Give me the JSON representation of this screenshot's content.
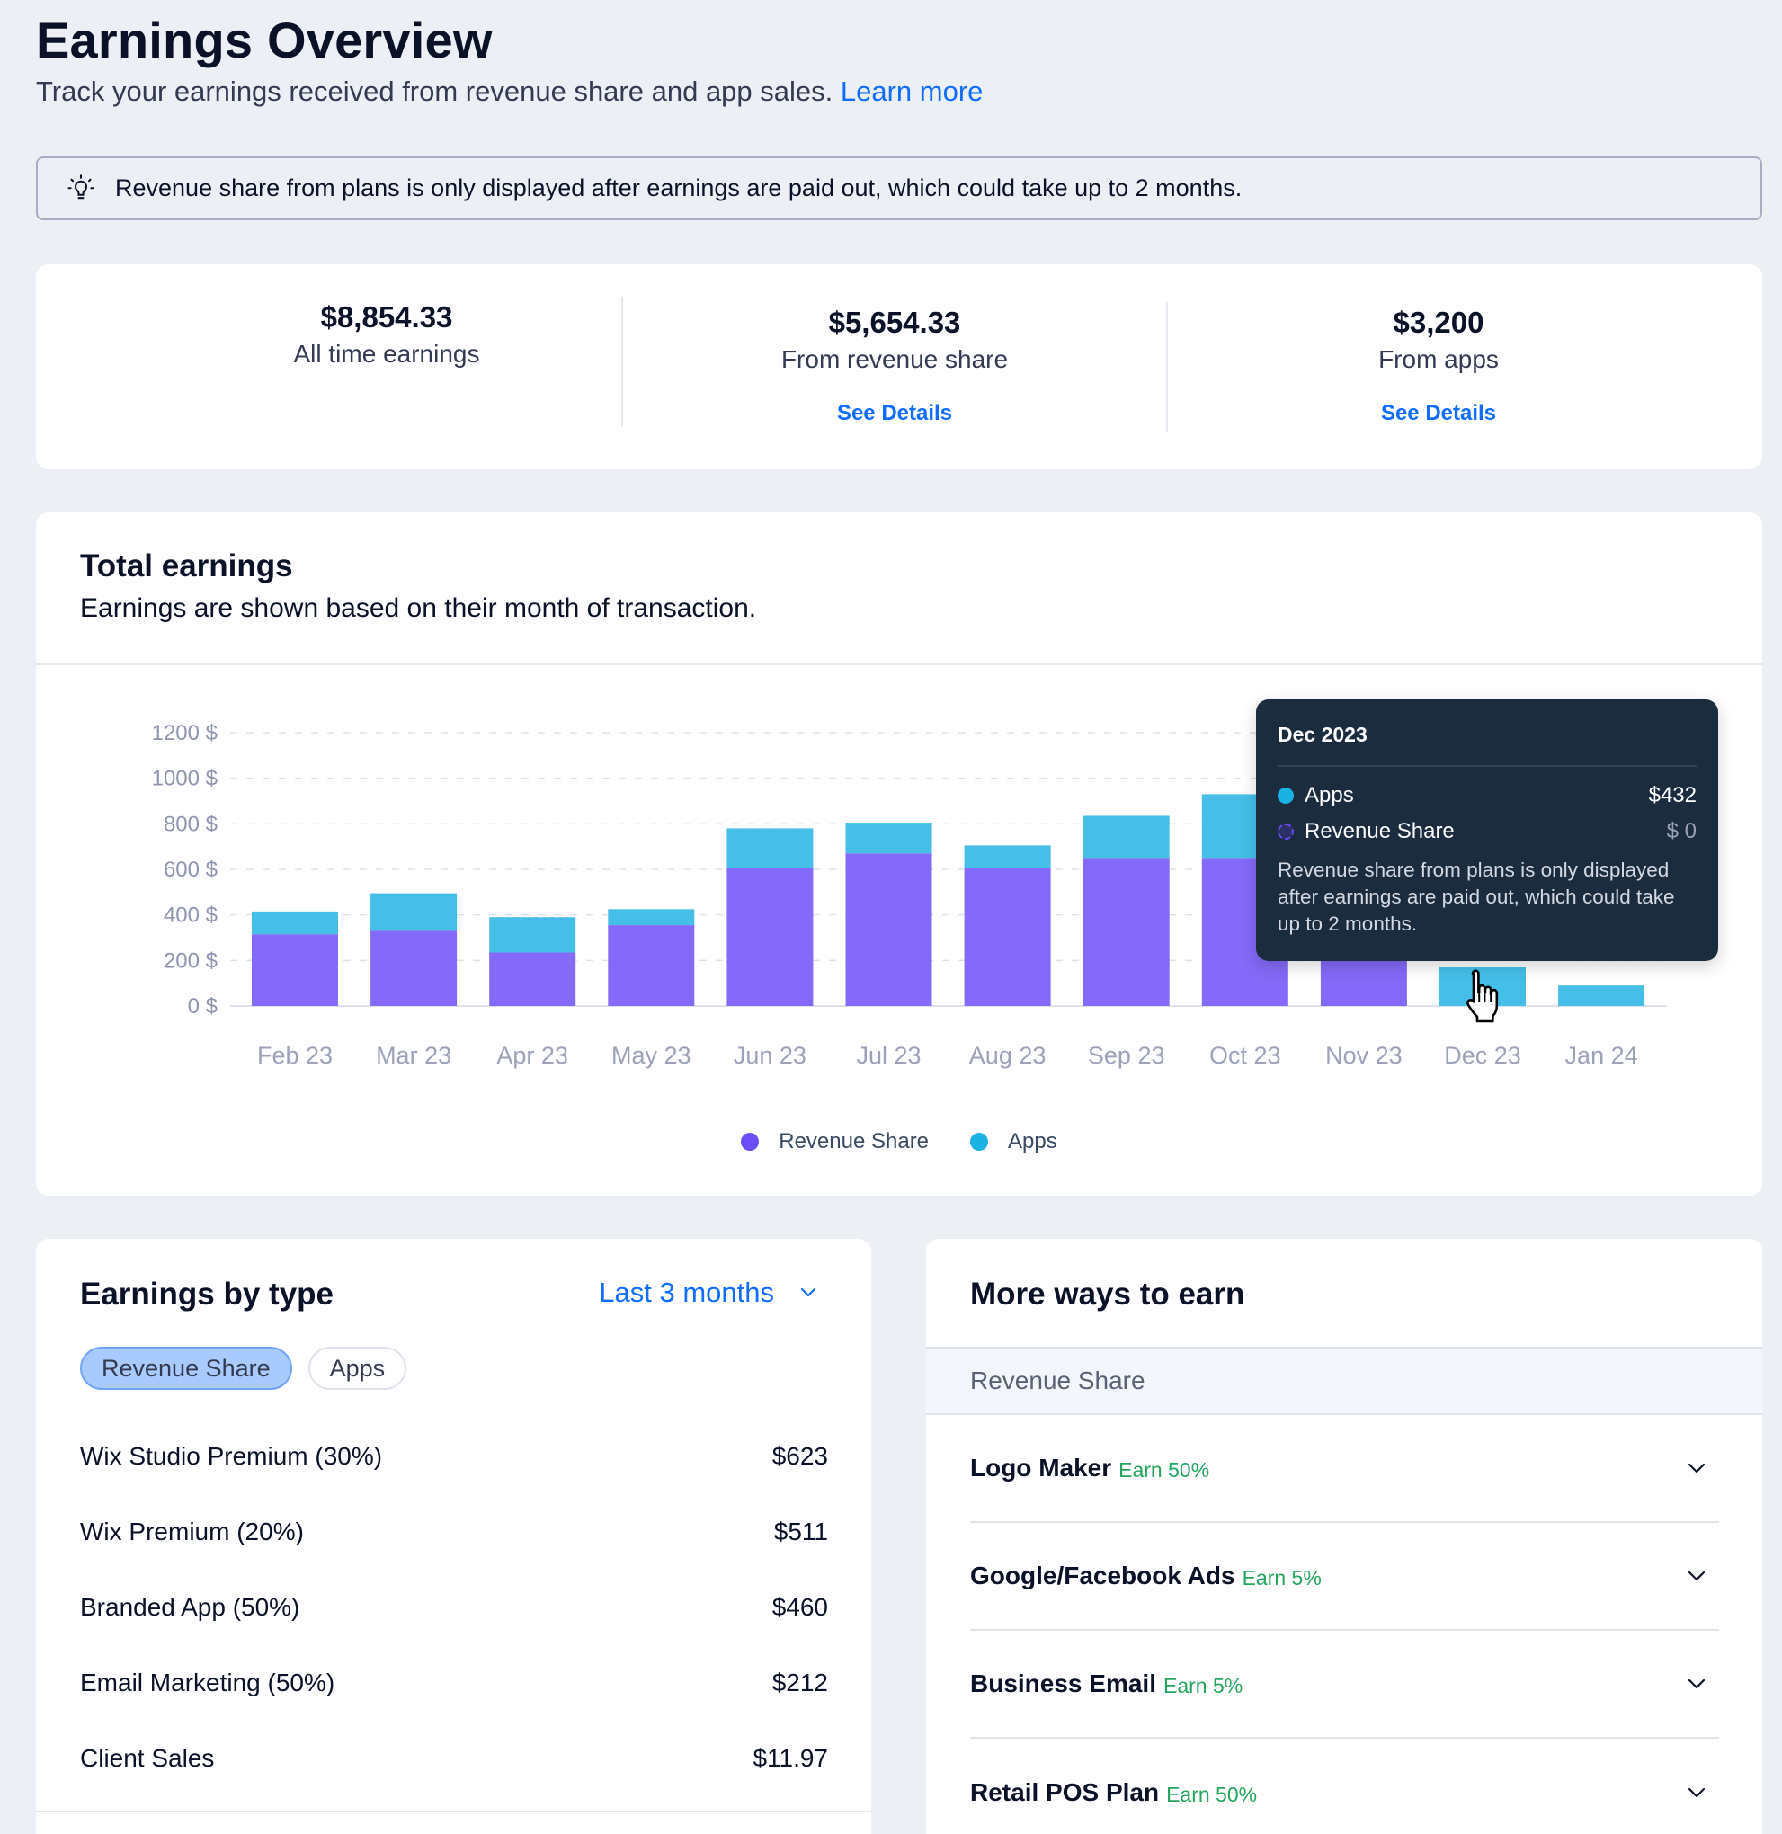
{
  "header": {
    "title": "Earnings Overview",
    "subtitle": "Track your earnings received from revenue share and app sales.",
    "learn_more": "Learn more"
  },
  "banner": {
    "icon": "lightbulb-icon",
    "text": "Revenue share from plans is only displayed after earnings are paid out, which could take up to 2 months."
  },
  "stats": [
    {
      "amount": "$8,854.33",
      "label": "All time earnings"
    },
    {
      "amount": "$5,654.33",
      "label": "From revenue share",
      "link": "See Details"
    },
    {
      "amount": "$3,200",
      "label": "From apps",
      "link": "See Details"
    }
  ],
  "total_earnings": {
    "title": "Total earnings",
    "subtitle": "Earnings are shown based on their month of transaction."
  },
  "colors": {
    "revenue_share": "#8569F8",
    "apps": "#45BFE8",
    "legend_revenue_share": "#6B4CF6",
    "legend_apps": "#1AB2E3",
    "accent": "#116DFF",
    "earn_green": "#25A55F"
  },
  "chart_data": {
    "type": "bar",
    "stacked": true,
    "title": "Total earnings",
    "xlabel": "",
    "ylabel": "",
    "categories": [
      "Feb 23",
      "Mar 23",
      "Apr 23",
      "May 23",
      "Jun 23",
      "Jul 23",
      "Aug 23",
      "Sep 23",
      "Oct 23",
      "Nov 23",
      "Dec 23",
      "Jan 24"
    ],
    "series": [
      {
        "name": "Revenue Share",
        "values": [
          315,
          330,
          235,
          355,
          605,
          670,
          605,
          650,
          650,
          650,
          0,
          0
        ]
      },
      {
        "name": "Apps",
        "values": [
          100,
          165,
          155,
          70,
          175,
          135,
          100,
          185,
          280,
          200,
          170,
          90
        ]
      }
    ],
    "ylim": [
      0,
      1200
    ],
    "yticks": [
      0,
      200,
      400,
      600,
      800,
      1000,
      1200
    ],
    "ytick_labels": [
      "0 $",
      "200 $",
      "400 $",
      "600 $",
      "800 $",
      "1000 $",
      "1200 $"
    ],
    "grid": true,
    "legend": "bottom-center",
    "legend_entries": [
      "Revenue Share",
      "Apps"
    ]
  },
  "tooltip": {
    "title": "Dec 2023",
    "rows": [
      {
        "name": "Apps",
        "value": "$432"
      },
      {
        "name": "Revenue Share",
        "value": "$ 0"
      }
    ],
    "note": "Revenue share from plans is only displayed after earnings are paid out, which could take up to 2 months."
  },
  "earnings_by_type": {
    "title": "Earnings by type",
    "period": "Last 3 months",
    "chips": [
      {
        "label": "Revenue Share",
        "active": true
      },
      {
        "label": "Apps",
        "active": false
      }
    ],
    "rows": [
      {
        "name": "Wix Studio Premium (30%)",
        "amount": "$623"
      },
      {
        "name": "Wix Premium (20%)",
        "amount": "$511"
      },
      {
        "name": "Branded App (50%)",
        "amount": "$460"
      },
      {
        "name": "Email Marketing (50%)",
        "amount": "$212"
      },
      {
        "name": "Client Sales",
        "amount": "$11.97"
      }
    ]
  },
  "more_ways": {
    "title": "More ways to earn",
    "section": "Revenue Share",
    "items": [
      {
        "name": "Logo Maker",
        "earn": "Earn 50%"
      },
      {
        "name": "Google/Facebook Ads",
        "earn": "Earn 5%"
      },
      {
        "name": "Business Email",
        "earn": "Earn 5%"
      },
      {
        "name": "Retail POS Plan",
        "earn": "Earn 50%"
      }
    ]
  }
}
